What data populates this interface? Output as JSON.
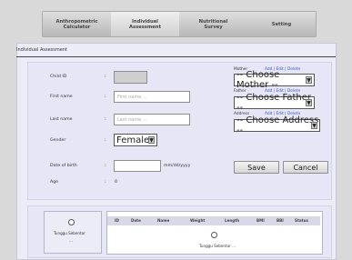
{
  "nav": {
    "tabs": [
      {
        "label_line1": "Anthropometric",
        "label_line2": "Calculator"
      },
      {
        "label_line1": "Individual",
        "label_line2": "Assessment"
      },
      {
        "label_line1": "Nutritional",
        "label_line2": "Survey"
      },
      {
        "label_line1": "Setting",
        "label_line2": ""
      }
    ]
  },
  "panel": {
    "title": "Individual Assessment"
  },
  "form": {
    "child_id_label": "Child ID",
    "first_name_label": "First name",
    "first_name_placeholder": "First name ...",
    "last_name_label": "Last name",
    "last_name_placeholder": "Last name ...",
    "gender_label": "Gender",
    "gender_value": "Female",
    "dob_label": "Date of birth",
    "dob_format": "mm/dd/yyyy",
    "age_label": "Age",
    "age_value": "0",
    "colon": ":"
  },
  "parents": {
    "mother_label": "Mother",
    "mother_links": "Add | Edit | Delete",
    "mother_select": "-- Choose Mother --",
    "father_label": "Father",
    "father_links": "Add | Edit | Delete",
    "father_select": "-- Choose Father --",
    "address_label": "Address",
    "address_links": "Add | Edit | Delete",
    "address_select": "-- Choose Address --"
  },
  "buttons": {
    "save": "Save",
    "cancel": "Cancel"
  },
  "bottom": {
    "left_wait": "Tunggu Sebentar",
    "left_dots": "...",
    "table_headers": [
      "ID",
      "Date",
      "Name",
      "Weight",
      "Length",
      "BMI",
      "BBI",
      "Status"
    ],
    "table_wait": "Tunggu Sebentar ..."
  }
}
